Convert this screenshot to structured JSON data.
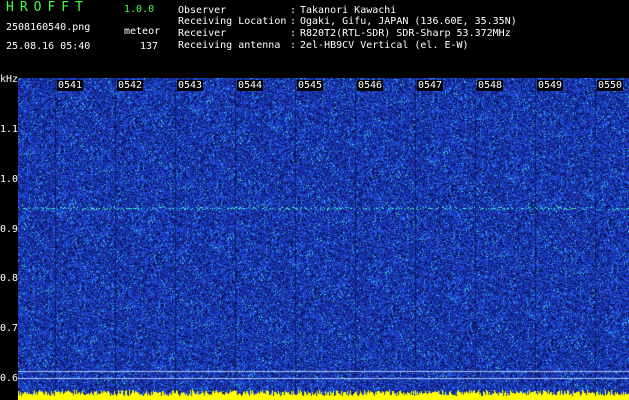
{
  "app": {
    "title": "HROFFT",
    "version": "1.0.0"
  },
  "file": {
    "name": "2508160540.png",
    "timestamp": "25.08.16 05:40"
  },
  "counter": {
    "label": "meteor",
    "value": "137"
  },
  "info": [
    {
      "key": "Observer",
      "value": "Takanori Kawachi"
    },
    {
      "key": "Receiving Location",
      "value": "Ogaki, Gifu, JAPAN (136.60E, 35.35N)"
    },
    {
      "key": "Receiver",
      "value": "R820T2(RTL-SDR) SDR-Sharp 53.372MHz"
    },
    {
      "key": "Receiving antenna",
      "value": "2el-HB9CV Vertical (el. E-W)"
    }
  ],
  "axis": {
    "unit": "kHz",
    "y_ticks": [
      "1.1",
      "1.0",
      "0.9",
      "0.8",
      "0.7",
      "0.6"
    ],
    "x_ticks": [
      "0541",
      "0542",
      "0543",
      "0544",
      "0545",
      "0546",
      "0547",
      "0548",
      "0549",
      "0550"
    ]
  },
  "colors": {
    "background": "#1a2e9c",
    "noise": "#2c5cff",
    "signal": "#40ffd0",
    "meter": "#ffff00"
  }
}
